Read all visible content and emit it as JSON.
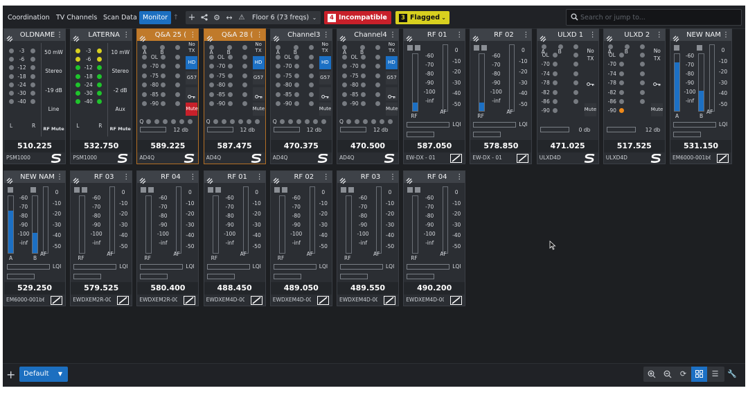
{
  "nav": {
    "items": [
      {
        "label": "Coordination",
        "active": false
      },
      {
        "label": "TV Channels",
        "active": false
      },
      {
        "label": "Scan Data",
        "active": false
      },
      {
        "label": "Monitor",
        "active": true
      }
    ],
    "up_icon": "arrow-up-icon"
  },
  "toolbar": {
    "floor_label": "Floor 6 (73 freqs)",
    "icons": [
      "plus-icon",
      "share-icon",
      "gear-icon",
      "arrows-horizontal-icon",
      "warning-icon"
    ]
  },
  "filters": [
    {
      "count": "4",
      "label": "Incompatible",
      "color": "#c8202a",
      "textcolor": "#ffffff"
    },
    {
      "count": "3",
      "label": "Flagged",
      "color": "#d8d01f",
      "textcolor": "#111111"
    }
  ],
  "search": {
    "placeholder": "Search or jump to..."
  },
  "meter_scale": [
    "-60",
    "-70",
    "-80",
    "-90",
    "-100",
    "-inf"
  ],
  "af_scale": [
    "0",
    "-10",
    "-20",
    "-30",
    "-40",
    "-50"
  ],
  "psm_scale": [
    "-3",
    "-6",
    "-12",
    "-18",
    "-24",
    "-30",
    "-40"
  ],
  "ad4q_scale": [
    "OL",
    "-70",
    "-75",
    "-80",
    "-85",
    "-90"
  ],
  "ulxd_scale": [
    "OL",
    "-70",
    "-74",
    "-78",
    "-82",
    "-86",
    "-90"
  ],
  "channels": [
    {
      "type": "psm",
      "name": "OLDNAME",
      "freq": "510.225",
      "model": "PSM1000",
      "brand": "shure",
      "highlight": false,
      "lit": 0,
      "sidebtns": [
        "50 mW",
        "Stereo",
        "-19 dB",
        "Line",
        "RF Mute"
      ],
      "lr": [
        "L",
        "R"
      ]
    },
    {
      "type": "psm",
      "name": "LATERNA",
      "freq": "532.750",
      "model": "PSM1000",
      "brand": "shure",
      "highlight": false,
      "lit": 1,
      "sidebtns": [
        "10 mW",
        "Stereo",
        "-2 dB",
        "Aux",
        "RF Mute"
      ],
      "lr": [
        "L",
        "R"
      ]
    },
    {
      "type": "ad4q",
      "name": "Q&A 25 (",
      "freq": "589.225",
      "model": "AD4Q",
      "brand": "shure",
      "highlight": true,
      "mute_on": true,
      "ab": [
        "A",
        "B"
      ],
      "q": "Q",
      "db": "12 db",
      "tbtns": [
        "No TX",
        "HD",
        "G57",
        "key-icon",
        "Mute"
      ]
    },
    {
      "type": "ad4q",
      "name": "Q&A 28 (",
      "freq": "587.475",
      "model": "AD4Q",
      "brand": "shure",
      "highlight": true,
      "mute_on": false,
      "ab": [
        "A",
        "B"
      ],
      "q": "Q",
      "db": "12 db",
      "tbtns": [
        "No TX",
        "HD",
        "G57",
        "key-icon",
        "Mute"
      ]
    },
    {
      "type": "ad4q",
      "name": "Channel3",
      "freq": "470.375",
      "model": "AD4Q",
      "brand": "shure",
      "highlight": false,
      "mute_on": false,
      "ab": [
        "A",
        "B"
      ],
      "q": "Q",
      "db": "12 db",
      "tbtns": [
        "No TX",
        "HD",
        "G57",
        "key-icon",
        "Mute"
      ]
    },
    {
      "type": "ad4q",
      "name": "Channel4",
      "freq": "470.500",
      "model": "AD4Q",
      "brand": "shure",
      "highlight": false,
      "mute_on": false,
      "ab": [
        "A",
        "B"
      ],
      "q": "Q",
      "db": "12 db",
      "tbtns": [
        "No TX",
        "HD",
        "G57",
        "key-icon",
        "Mute"
      ]
    },
    {
      "type": "ew",
      "name": "RF 01",
      "freq": "587.050",
      "model": "EW-DX - 01",
      "brand": "sennheiser",
      "rf_level": 0.15,
      "diversity": false,
      "rf": "RF",
      "af": "AF",
      "lqi": "LQI"
    },
    {
      "type": "ew",
      "name": "RF 02",
      "freq": "578.850",
      "model": "EW-DX - 01",
      "brand": "sennheiser",
      "rf_level": 0.15,
      "diversity": false,
      "rf": "RF",
      "af": "AF",
      "lqi": "LQI"
    },
    {
      "type": "ulxd",
      "name": "ULXD 1",
      "freq": "471.025",
      "model": "ULXD4D",
      "brand": "shure",
      "orange": false,
      "ab": [
        "A",
        "B"
      ],
      "db": "0 db",
      "tbtns": [
        "No TX",
        "key-icon",
        "Mute"
      ]
    },
    {
      "type": "ulxd",
      "name": "ULXD 2",
      "freq": "517.525",
      "model": "ULXD4D",
      "brand": "shure",
      "orange": true,
      "ab": [
        "A",
        "B"
      ],
      "db": "12 db",
      "tbtns": [
        "No TX",
        "key-icon",
        "Mute"
      ]
    },
    {
      "type": "ew",
      "name": "NEW NAM",
      "freq": "531.150",
      "model": "EM6000-001b6...",
      "brand": "sennheiser",
      "rf_level": 0.85,
      "af_level": 0.35,
      "diversity": true,
      "ab": [
        "A",
        "B"
      ],
      "af": "AF",
      "lqi": "LQI"
    },
    {
      "type": "ew",
      "name": "NEW NAM",
      "freq": "529.250",
      "model": "EM6000-001b6...",
      "brand": "sennheiser",
      "rf_level": 0.75,
      "af_level": 0.35,
      "diversity": true,
      "ab": [
        "A",
        "B"
      ],
      "af": "AF",
      "lqi": "LQI"
    },
    {
      "type": "ew",
      "name": "RF 03",
      "freq": "579.525",
      "model": "EWDXEM2R-00...",
      "brand": "sennheiser",
      "rf_level": 0,
      "diversity": false,
      "rf": "RF",
      "af": "AF",
      "lqi": "LQI"
    },
    {
      "type": "ew",
      "name": "RF 04",
      "freq": "580.400",
      "model": "EWDXEM2R-00...",
      "brand": "sennheiser",
      "rf_level": 0,
      "diversity": false,
      "rf": "RF",
      "af": "AF",
      "lqi": "LQI"
    },
    {
      "type": "ew",
      "name": "RF 01",
      "freq": "488.450",
      "model": "EWDXEM4D-00...",
      "brand": "sennheiser",
      "rf_level": 0,
      "diversity": false,
      "rf": "RF",
      "af": "AF",
      "lqi": "LQI"
    },
    {
      "type": "ew",
      "name": "RF 02",
      "freq": "489.050",
      "model": "EWDXEM4D-00...",
      "brand": "sennheiser",
      "rf_level": 0,
      "diversity": false,
      "rf": "RF",
      "af": "AF",
      "lqi": "LQI"
    },
    {
      "type": "ew",
      "name": "RF 03",
      "freq": "489.550",
      "model": "EWDXEM4D-00...",
      "brand": "sennheiser",
      "rf_level": 0,
      "diversity": false,
      "rf": "RF",
      "af": "AF",
      "lqi": "LQI"
    },
    {
      "type": "ew",
      "name": "RF 04",
      "freq": "490.200",
      "model": "EWDXEM4D-00...",
      "brand": "sennheiser",
      "rf_level": 0,
      "diversity": false,
      "rf": "RF",
      "af": "AF",
      "lqi": "LQI"
    }
  ],
  "bottom": {
    "tab_label": "Default",
    "view_icons": [
      "zoom-in-icon",
      "zoom-out-icon",
      "refresh-icon",
      "grid-view-icon",
      "list-view-icon"
    ],
    "active_view": "grid-view-icon",
    "tools_icon": "wrench-icon"
  }
}
